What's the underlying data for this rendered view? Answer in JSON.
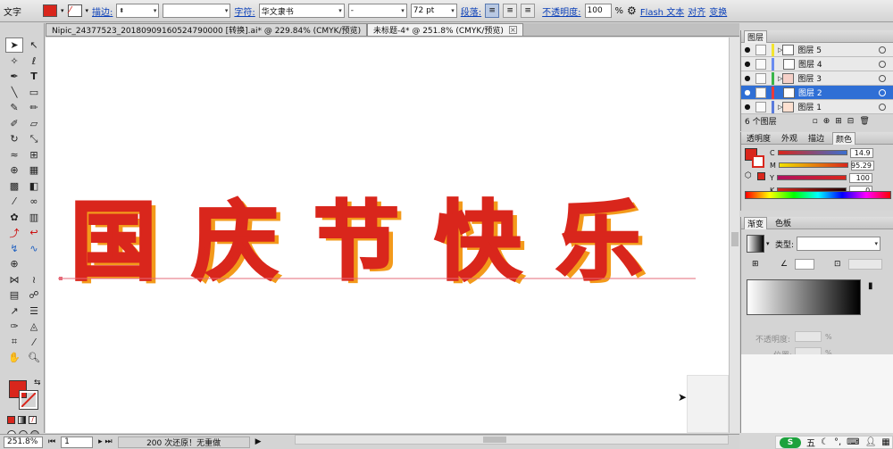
{
  "control_bar": {
    "tool_label": "文字",
    "stroke_label": "描边:",
    "char_label": "字符:",
    "font_family": "华文隶书",
    "font_style": "-",
    "font_size": "72 pt",
    "para_label": "段落:",
    "opacity_label": "不透明度:",
    "opacity_value": "100",
    "opacity_unit": "%",
    "flash_text": "Flash 文本",
    "align_label": "对齐",
    "transform_label": "变换",
    "fill_color": "#d9261c"
  },
  "tabs": [
    {
      "label": "Nipic_24377523_20180909160524790000  [转换].ai* @ 229.84% (CMYK/预览)"
    },
    {
      "label": "未标题-4* @ 251.8% (CMYK/预览)"
    }
  ],
  "artwork": {
    "text": "国庆节快乐",
    "fill": "#d9261c",
    "shadow": "#f39a1b"
  },
  "status": {
    "zoom": "251.8%",
    "page": "1",
    "message": "200 次还原！无重做"
  },
  "layers_panel": {
    "title": "图层",
    "layers": [
      {
        "name": "图层 5",
        "color": "#f2e430"
      },
      {
        "name": "图层 4",
        "color": "#f08ac8"
      },
      {
        "name": "图层 3",
        "color": "#39b54a"
      },
      {
        "name": "图层 2",
        "color": "#e93a3a",
        "selected": true
      },
      {
        "name": "图层 1",
        "color": "#5a7bdc"
      }
    ],
    "count": "6 个图层"
  },
  "color_panel": {
    "tabs": [
      "透明度",
      "外观",
      "描边",
      "颜色"
    ],
    "c": "14.9",
    "m": "95.29",
    "y": "100",
    "k": "0",
    "labels": [
      "C",
      "M",
      "Y",
      "K"
    ]
  },
  "gradient_panel": {
    "tabs": [
      "渐变",
      "色板"
    ],
    "type_label": "类型:",
    "opacity_label": "不透明度:",
    "location_label": "位置:"
  },
  "ime": {
    "brand": "S",
    "mode": "五"
  }
}
